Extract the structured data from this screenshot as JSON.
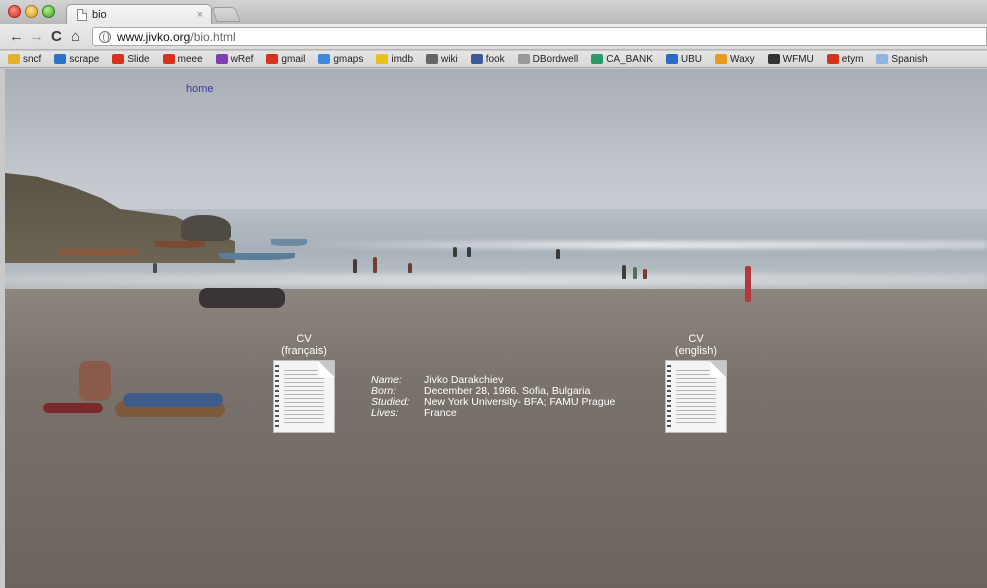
{
  "browser": {
    "tab_title": "bio",
    "tab_close": "×",
    "url_host": "www.jivko.org",
    "url_path": "/bio.html",
    "nav": {
      "back": "←",
      "forward": "→",
      "reload": "C",
      "home": "⌂"
    }
  },
  "bookmarks": [
    {
      "label": "sncf",
      "icon": "grid-icon",
      "color": "#e6b12a"
    },
    {
      "label": "scrape",
      "icon": "bird-icon",
      "color": "#2a74c8"
    },
    {
      "label": "Slide",
      "icon": "stumble-icon",
      "color": "#d8321c"
    },
    {
      "label": "meee",
      "icon": "stumble-icon",
      "color": "#d8321c"
    },
    {
      "label": "wRef",
      "icon": "w-icon",
      "color": "#7f3fb0"
    },
    {
      "label": "gmail",
      "icon": "stumble-icon",
      "color": "#d8321c"
    },
    {
      "label": "gmaps",
      "icon": "maps-icon",
      "color": "#3b8ad9"
    },
    {
      "label": "imdb",
      "icon": "imdb-icon",
      "color": "#e8c21a"
    },
    {
      "label": "wiki",
      "icon": "wiki-icon",
      "color": "#666666"
    },
    {
      "label": "fook",
      "icon": "facebook-icon",
      "color": "#3b5998"
    },
    {
      "label": "DBordwell",
      "icon": "globe-icon",
      "color": "#999999"
    },
    {
      "label": "CA_BANK",
      "icon": "bank-icon",
      "color": "#2a9a6a"
    },
    {
      "label": "UBU",
      "icon": "ubu-icon",
      "color": "#2a6ac8"
    },
    {
      "label": "Waxy",
      "icon": "waxy-icon",
      "color": "#e89a1a"
    },
    {
      "label": "WFMU",
      "icon": "wfmu-icon",
      "color": "#333333"
    },
    {
      "label": "etym",
      "icon": "stumble-icon",
      "color": "#d8321c"
    },
    {
      "label": "Spanish",
      "icon": "folder-icon",
      "color": "#8fb6e0"
    }
  ],
  "page": {
    "home_link": "home",
    "cv_fr": {
      "line1": "CV",
      "line2": "(français)"
    },
    "cv_en": {
      "line1": "CV",
      "line2": "(english)"
    },
    "bio": [
      {
        "key": "Name:",
        "value": "Jivko Darakchiev"
      },
      {
        "key": "Born:",
        "value": "December 28, 1986. Sofia, Bulgaria"
      },
      {
        "key": "Studied:",
        "value": "New York University- BFA; FAMU Prague"
      },
      {
        "key": "Lives:",
        "value": "France"
      }
    ]
  }
}
